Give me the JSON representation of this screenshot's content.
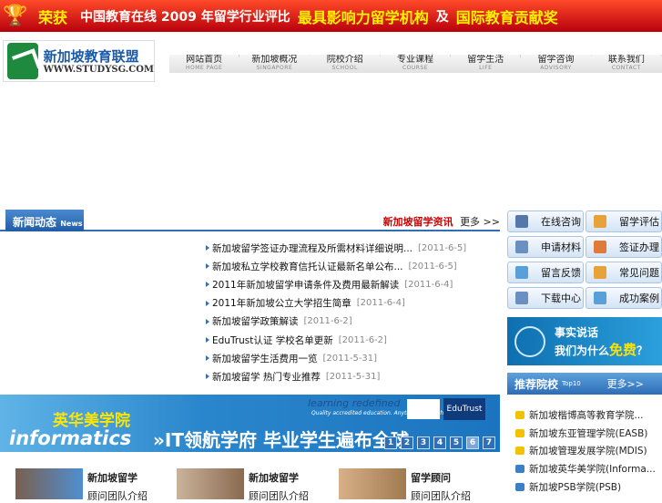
{
  "banner": {
    "t1": "荣获",
    "t2": "中国教育在线 2009 年留学行业评比",
    "t3": "最具影响力留学机构",
    "t4": "及",
    "t5": "国际教育贡献奖"
  },
  "logo": {
    "cn": "新加坡教育联盟",
    "en": "WWW.STUDYSG.COM"
  },
  "nav": [
    {
      "cn": "网站首页",
      "en": "HOME PAGE"
    },
    {
      "cn": "新加坡概况",
      "en": "SINGAPORE"
    },
    {
      "cn": "院校介绍",
      "en": "SCHOOL"
    },
    {
      "cn": "专业课程",
      "en": "COURSE"
    },
    {
      "cn": "留学生活",
      "en": "LIFE"
    },
    {
      "cn": "留学咨询",
      "en": "ADVISORY"
    },
    {
      "cn": "联系我们",
      "en": "CONTACT"
    }
  ],
  "news": {
    "tab": "新闻动态",
    "tab_en": "News",
    "highlight": "新加坡留学资讯",
    "more": "更多 >>",
    "items": [
      {
        "title": "新加坡留学签证办理流程及所需材料详细说明...",
        "date": "[2011-6-5]"
      },
      {
        "title": "新加坡私立学校教育信托认证最新名单公布...",
        "date": "[2011-6-5]"
      },
      {
        "title": "2011年新加坡留学申请条件及费用最新解读",
        "date": "[2011-6-4]"
      },
      {
        "title": "2011年新加坡公立大学招生简章",
        "date": "[2011-6-4]"
      },
      {
        "title": "新加坡留学政策解读",
        "date": "[2011-6-2]"
      },
      {
        "title": "EduTrust认证 学校名单更新",
        "date": "[2011-6-2]"
      },
      {
        "title": "新加坡留学生活费用一览",
        "date": "[2011-5-31]"
      },
      {
        "title": "新加坡留学 热门专业推荐",
        "date": "[2011-5-31]"
      }
    ]
  },
  "quick": [
    {
      "label": "在线咨询",
      "icon": "user-icon",
      "color": "#5577aa"
    },
    {
      "label": "留学评估",
      "icon": "cursor-icon",
      "color": "#e8a23a"
    },
    {
      "label": "申请材料",
      "icon": "document-icon",
      "color": "#6a8fc0"
    },
    {
      "label": "签证办理",
      "icon": "umbrella-icon",
      "color": "#e07a3a"
    },
    {
      "label": "留言反馈",
      "icon": "chat-icon",
      "color": "#5aa0d8"
    },
    {
      "label": "常见问题",
      "icon": "cursor-icon",
      "color": "#e8a23a"
    },
    {
      "label": "下载中心",
      "icon": "document-icon",
      "color": "#6a8fc0"
    },
    {
      "label": "成功案例",
      "icon": "chat-icon",
      "color": "#5aa0d8"
    }
  ],
  "fact": {
    "line1": "事实说话",
    "line2a": "我们为什么",
    "line2b": "免费",
    "line2c": "？"
  },
  "recommend": {
    "title": "推荐院校",
    "sub": "Top10",
    "more": "更多>>",
    "items": [
      {
        "name": "新加坡楷博高等教育学院...",
        "color": "#f2c200"
      },
      {
        "name": "新加坡东亚管理学院(EASB)",
        "color": "#f2c200"
      },
      {
        "name": "新加坡管理发展学院(MDIS)",
        "color": "#f2c200"
      },
      {
        "name": "新加坡英华美学院(Informa...",
        "color": "#3b7fc4"
      },
      {
        "name": "新加坡PSB学院(PSB)",
        "color": "#3b7fc4"
      }
    ]
  },
  "ad": {
    "school": "英华美学院",
    "brand": "informatics",
    "slogan": "»IT领航学府 毕业学生遍布全球",
    "tag1": "learning redefined",
    "tag2": "Quality accredited education. Anytime. Everywhere.",
    "edu": "EduTrust",
    "pages": [
      "1",
      "2",
      "3",
      "4",
      "5",
      "6",
      "7"
    ]
  },
  "people": [
    {
      "name": "新加坡留学",
      "sub": "顾问团队介绍"
    },
    {
      "name": "新加坡留学",
      "sub": "顾问团队介绍"
    },
    {
      "name": "留学顾问",
      "sub": "顾问团队介绍"
    }
  ]
}
